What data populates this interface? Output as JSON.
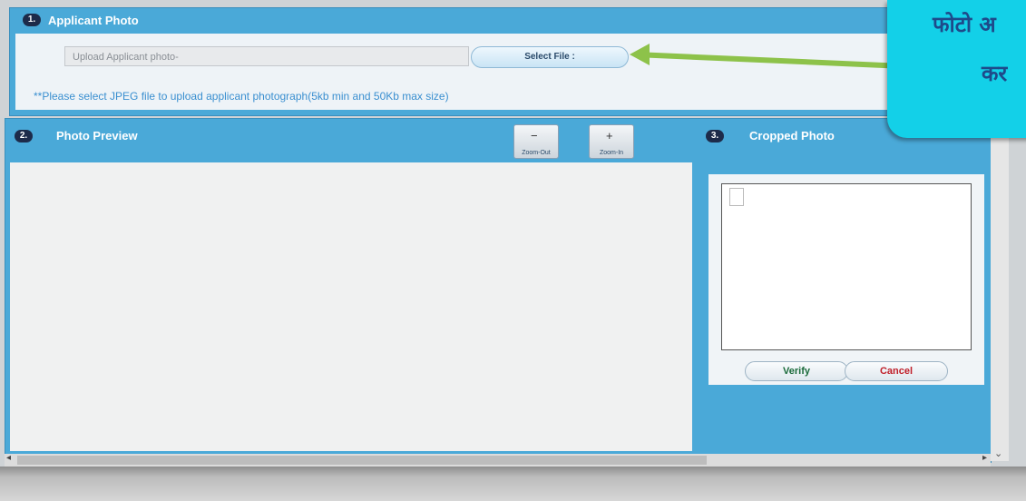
{
  "applicant_photo": {
    "step": "1.",
    "title": "Applicant Photo",
    "placeholder": "Upload Applicant photo-",
    "select_label": "Select File :",
    "hint": "**Please select JPEG file to upload applicant photograph(5kb min and 50Kb max size)"
  },
  "callout": {
    "line1": "फोटो अ",
    "line2": "कर"
  },
  "photo_preview": {
    "step": "2.",
    "title": "Photo Preview",
    "zoom_out": "Zoom-Out",
    "zoom_in": "Zoom-In",
    "zoom_out_glyph": "−",
    "zoom_in_glyph": "+"
  },
  "cropped_photo": {
    "step": "3.",
    "title": "Cropped Photo",
    "verify": "Verify",
    "cancel": "Cancel"
  },
  "colors": {
    "panel": "#4aa9d8",
    "badge": "#1d2b4a",
    "arrow": "#8dc24a",
    "callout": "#13d0e8",
    "verify_text": "#1a6a3a",
    "cancel_text": "#c0202a"
  },
  "icons": {
    "zoom_out": "zoom-out-icon",
    "zoom_in": "zoom-in-icon",
    "scroll_left": "scroll-left-arrow-icon",
    "scroll_right": "scroll-right-arrow-icon",
    "scroll_down": "scroll-down-arrow-icon"
  }
}
